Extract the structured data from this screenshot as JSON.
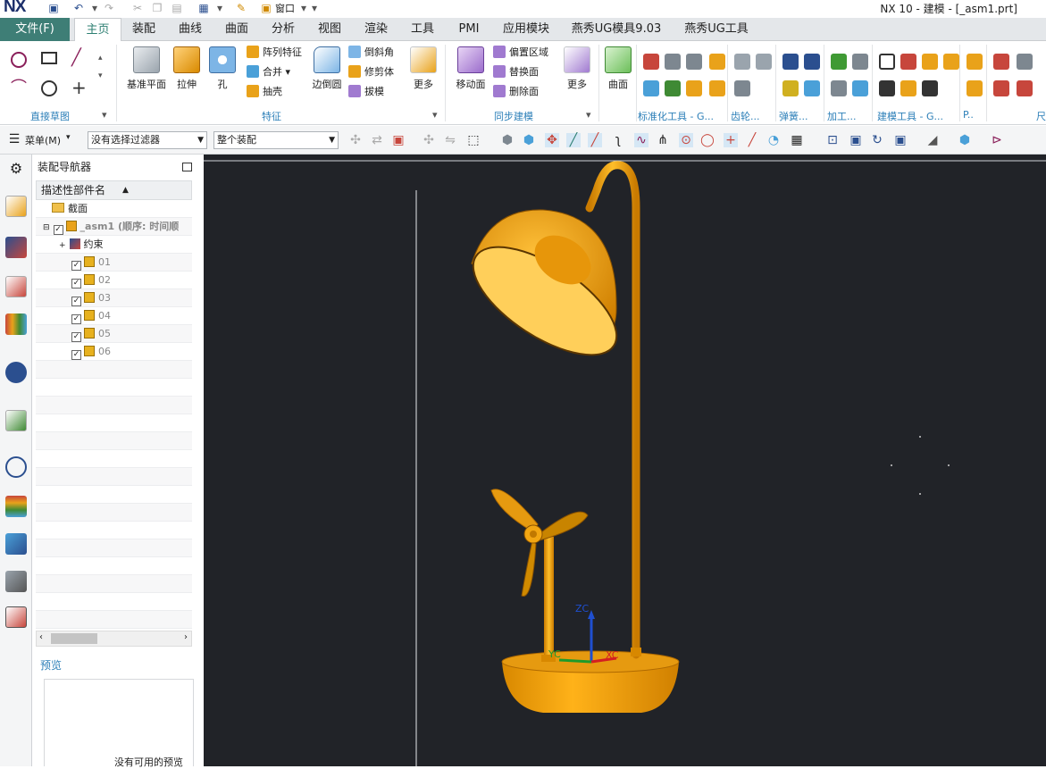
{
  "app": {
    "logo": "NX",
    "window_title": "NX 10 - 建模 - [_asm1.prt]",
    "window_menu": "窗口"
  },
  "tabs": [
    "文件(F)",
    "主页",
    "装配",
    "曲线",
    "曲面",
    "分析",
    "视图",
    "渲染",
    "工具",
    "PMI",
    "应用模块",
    "燕秀UG模具9.03",
    "燕秀UG工具"
  ],
  "ribbon": {
    "groups": {
      "sketch": "直接草图",
      "feature": "特征",
      "sync": "同步建模",
      "std": "标准化工具 - G...",
      "gear": "齿轮...",
      "spring": "弹簧...",
      "machining": "加工...",
      "build": "建模工具 - G...",
      "p": "P..",
      "size": "尺"
    },
    "buttons": {
      "datum_plane": "基准平面",
      "extrude": "拉伸",
      "hole": "孔",
      "array_feature": "阵列特征",
      "unite": "合并",
      "shell": "抽壳",
      "edge_blend": "边倒圆",
      "chamfer": "倒斜角",
      "trim_body": "修剪体",
      "draft": "拔模",
      "more1": "更多",
      "move_face": "移动面",
      "offset_region": "偏置区域",
      "replace_face": "替换面",
      "delete_face": "删除面",
      "more2": "更多",
      "surface": "曲面"
    }
  },
  "toolbar2": {
    "menu_label": "菜单(M)",
    "filter_value": "没有选择过滤器",
    "scope_value": "整个装配"
  },
  "navigator": {
    "title": "装配导航器",
    "column_header": "描述性部件名",
    "rows": [
      {
        "label": "截面"
      },
      {
        "label": "_asm1 (顺序: 时间顺"
      },
      {
        "label": "约束"
      },
      {
        "label": "01"
      },
      {
        "label": "02"
      },
      {
        "label": "03"
      },
      {
        "label": "04"
      },
      {
        "label": "05"
      },
      {
        "label": "06"
      }
    ],
    "preview_title": "预览",
    "preview_empty": "没有可用的预览"
  },
  "viewport": {
    "axis_labels": {
      "z": "ZC",
      "y": "YC",
      "x": "XC"
    },
    "model_color": "#f5a60f"
  }
}
